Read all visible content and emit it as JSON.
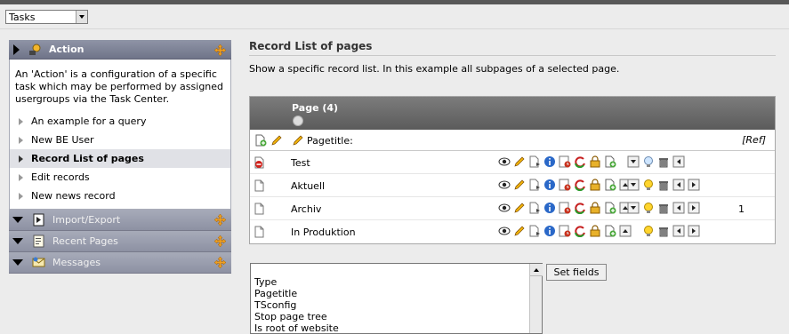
{
  "task_select": {
    "value": "Tasks"
  },
  "sidebar": {
    "action_section": {
      "title": "Action",
      "description": "An 'Action' is a configuration of a specific task which may be performed by assigned usergroups via the Task Center.",
      "items": [
        {
          "label": "An example for a query"
        },
        {
          "label": "New BE User"
        },
        {
          "label": "Record List of pages"
        },
        {
          "label": "Edit records"
        },
        {
          "label": "New news record"
        }
      ]
    },
    "collapsed_sections": [
      {
        "title": "Import/Export"
      },
      {
        "title": "Recent Pages"
      },
      {
        "title": "Messages"
      }
    ]
  },
  "main": {
    "title": "Record List of pages",
    "description": "Show a specific record list. In this example all subpages of a selected page.",
    "table": {
      "header_title": "Page (4)",
      "subheader_label": "Pagetitle:",
      "subheader_ref": "[Ref]",
      "rows": [
        {
          "title": "Test",
          "extra": ""
        },
        {
          "title": "Aktuell",
          "extra": ""
        },
        {
          "title": "Archiv",
          "extra": "1"
        },
        {
          "title": "In Produktion",
          "extra": ""
        }
      ]
    },
    "fields": {
      "items": [
        "Type",
        "Pagetitle",
        "TSconfig",
        "Stop page tree",
        "Is root of website"
      ],
      "button_label": "Set fields"
    }
  }
}
